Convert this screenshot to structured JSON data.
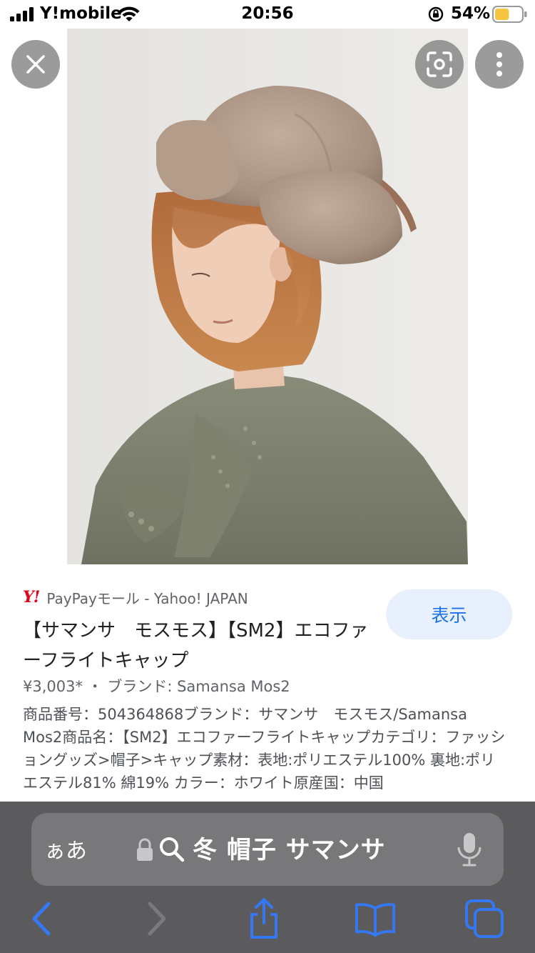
{
  "status_bar": {
    "carrier": "Y!mobile",
    "time": "20:56",
    "battery_percent": "54%",
    "battery_level": 0.54,
    "battery_color": "#f5c542"
  },
  "image_overlay": {
    "close_icon": "close-icon",
    "lens_icon": "lens-icon",
    "more_icon": "more-vertical-icon"
  },
  "result": {
    "source_logo": "Y!",
    "source": "PayPayモール - Yahoo! JAPAN",
    "title": "【サマンサ　モスモス】【SM2】エコファーフライトキャップ",
    "price_line": "¥3,003* ・ ブランド: Samansa Mos2",
    "description": "商品番号：504364868ブランド：サマンサ　モスモス/Samansa Mos2商品名：【SM2】エコファーフライトキャップカテゴリ：ファッショングッズ>帽子>キャップ素材：表地:ポリエステル100% 裏地:ポリエステル81% 綿19% カラー：ホワイト原産国：中国",
    "show_button": "表示",
    "accent_color": "#1a73e8"
  },
  "browser": {
    "aa_label": "ぁあ",
    "search_query": "冬 帽子 サマンサ",
    "bar_color": "#5b5b5d",
    "toolbar_tint": "#3478f6"
  }
}
